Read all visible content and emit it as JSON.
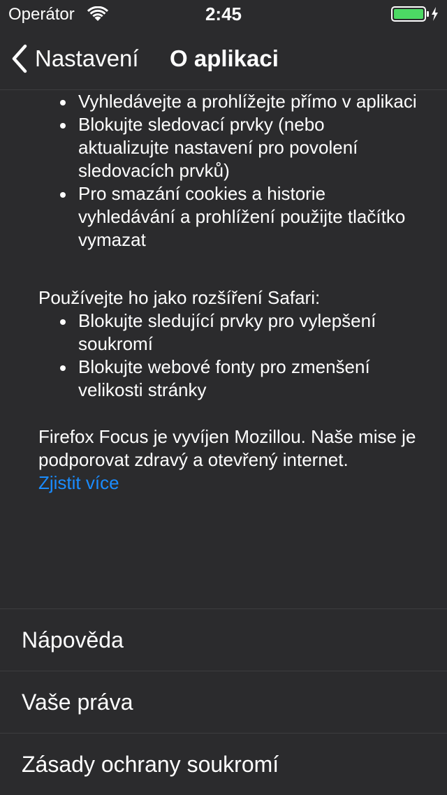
{
  "status_bar": {
    "carrier": "Operátor",
    "time": "2:45",
    "battery_color": "#4cd964"
  },
  "nav": {
    "back_label": "Nastavení",
    "title": "O aplikaci"
  },
  "content": {
    "app_bullets": [
      "Vyhledávejte a prohlížejte přímo v aplikaci",
      "Blokujte sledovací prvky (nebo aktualizujte nastavení pro povolení sledovacích prvků)",
      "Pro smazání cookies a historie vyhledávání a prohlížení použijte tlačítko vymazat"
    ],
    "safari_intro": "Používejte ho jako rozšíření Safari:",
    "safari_bullets": [
      "Blokujte sledující prvky pro vylepšení soukromí",
      "Blokujte webové fonty pro zmenšení velikosti stránky"
    ],
    "mission": "Firefox Focus je vyvíjen Mozillou. Naše mise je podporovat zdravý a otevřený internet.",
    "learn_more": "Zjistit více",
    "link_color": "#1a8cff"
  },
  "menu": {
    "items": [
      {
        "label": "Nápověda"
      },
      {
        "label": "Vaše práva"
      },
      {
        "label": "Zásady ochrany soukromí"
      }
    ]
  }
}
